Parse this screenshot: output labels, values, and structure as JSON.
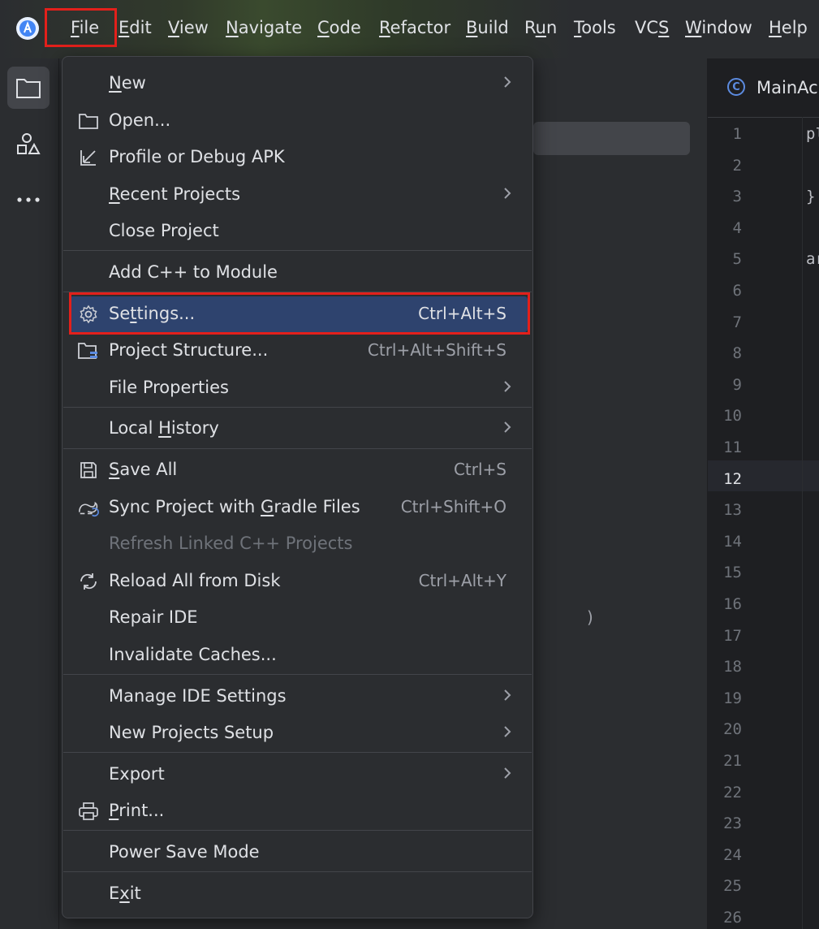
{
  "menubar": {
    "items": [
      {
        "label": "File",
        "mn": "F",
        "rest": "ile"
      },
      {
        "label": "Edit",
        "mn": "E",
        "rest": "dit"
      },
      {
        "label": "View",
        "mn": "V",
        "rest": "iew"
      },
      {
        "label": "Navigate",
        "mn": "N",
        "rest": "avigate"
      },
      {
        "label": "Code",
        "mn": "C",
        "rest": "ode"
      },
      {
        "label": "Refactor",
        "mn": "R",
        "rest": "efactor"
      },
      {
        "label": "Build",
        "mn": "B",
        "rest": "uild"
      },
      {
        "label": "Run",
        "pre": "R",
        "mn": "u",
        "rest": "n"
      },
      {
        "label": "Tools",
        "mn": "T",
        "rest": "ools"
      },
      {
        "label": "VCS",
        "pre": "VC",
        "mn": "S",
        "rest": ""
      },
      {
        "label": "Window",
        "mn": "W",
        "rest": "indow"
      },
      {
        "label": "Help",
        "mn": "H",
        "rest": "elp"
      }
    ]
  },
  "editor": {
    "tab_title": "MainAc",
    "tab_icon": "class-icon",
    "line_numbers": [
      "1",
      "2",
      "3",
      "4",
      "5",
      "6",
      "7",
      "8",
      "9",
      "10",
      "11",
      "12",
      "13",
      "14",
      "15",
      "16",
      "17",
      "18",
      "19",
      "20",
      "21",
      "22",
      "23",
      "24",
      "25",
      "26"
    ],
    "current_line": "12",
    "code_fragments": {
      "line1": "pl",
      "line3": "}",
      "line5": "ar"
    }
  },
  "project_panel": {
    "paren": ")"
  },
  "file_menu": {
    "items": {
      "new": {
        "pre": "",
        "mn": "N",
        "rest": "ew"
      },
      "open": {
        "label": "Open..."
      },
      "profile": {
        "label": "Profile or Debug APK"
      },
      "recent": {
        "pre": "",
        "mn": "R",
        "rest": "ecent Projects"
      },
      "close": {
        "label": "Close Project"
      },
      "addcpp": {
        "label": "Add C++ to Module"
      },
      "settings": {
        "pre": "Se",
        "mn": "t",
        "rest": "tings...",
        "shortcut": "Ctrl+Alt+S"
      },
      "structure": {
        "label": "Project Structure...",
        "shortcut": "Ctrl+Alt+Shift+S"
      },
      "fileprops": {
        "label": "File Properties"
      },
      "history": {
        "pre": "Local ",
        "mn": "H",
        "rest": "istory"
      },
      "saveall": {
        "pre": "",
        "mn": "S",
        "rest": "ave All",
        "shortcut": "Ctrl+S"
      },
      "sync": {
        "pre": "Sync Project with ",
        "mn": "G",
        "rest": "radle Files",
        "shortcut": "Ctrl+Shift+O"
      },
      "refresh": {
        "label": "Refresh Linked C++ Projects"
      },
      "reload": {
        "label": "Reload All from Disk",
        "shortcut": "Ctrl+Alt+Y"
      },
      "repair": {
        "label": "Repair IDE"
      },
      "invalidate": {
        "label": "Invalidate Caches..."
      },
      "manage": {
        "label": "Manage IDE Settings"
      },
      "newsetup": {
        "label": "New Projects Setup"
      },
      "export": {
        "label": "Export"
      },
      "print": {
        "pre": "",
        "mn": "P",
        "rest": "rint..."
      },
      "powersave": {
        "label": "Power Save Mode"
      },
      "exit": {
        "pre": "E",
        "mn": "x",
        "rest": "it"
      }
    }
  },
  "colors": {
    "highlight_border": "#e3201b",
    "selected_row": "#2e436e",
    "menu_bg": "#2b2d30",
    "accent_blue": "#5c8be0"
  }
}
